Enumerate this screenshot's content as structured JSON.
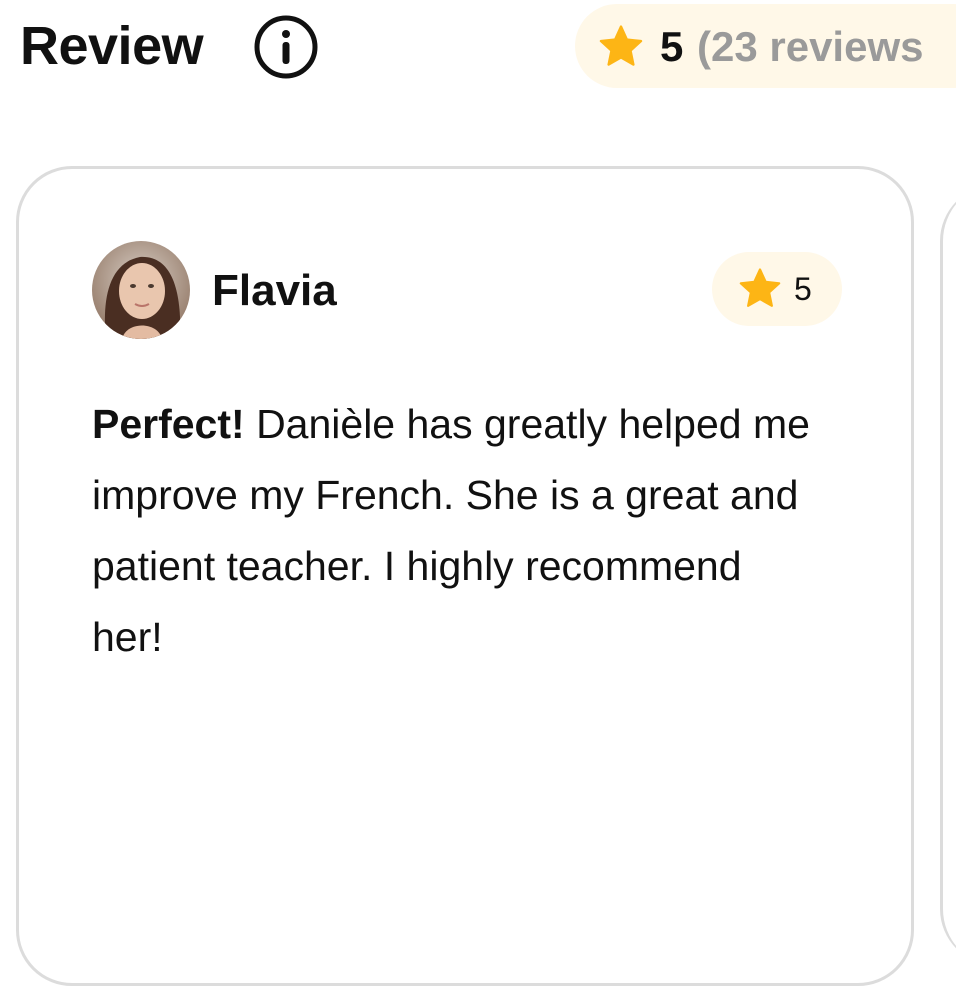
{
  "header": {
    "title": "Review",
    "info_icon": "info-circle-icon",
    "rating": {
      "star_icon": "star-icon",
      "average": "5",
      "count_text": "(23 reviews"
    }
  },
  "review": {
    "reviewer_name": "Flavia",
    "avatar": "reviewer-avatar",
    "rating": "5",
    "star_icon": "star-icon",
    "headline": "Perfect!",
    "body": "Danièle has greatly helped me improve my French. She is a great and patient teacher. I highly recommend her!"
  },
  "colors": {
    "star": "#FDB515",
    "pill_bg": "#FFF8E8",
    "card_border": "#DCDCDC",
    "muted_text": "#9A9A9A"
  }
}
